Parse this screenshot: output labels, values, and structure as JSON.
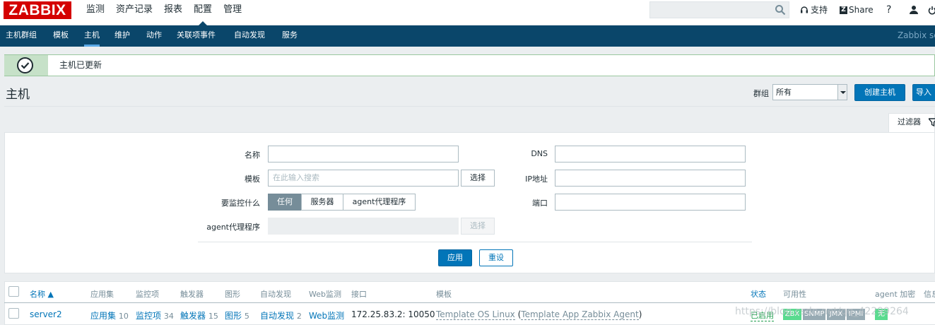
{
  "logo": "ZABBIX",
  "main_menu": [
    "监测",
    "资产记录",
    "报表",
    "配置",
    "管理"
  ],
  "main_menu_active": "配置",
  "search": {
    "placeholder": ""
  },
  "topright": {
    "support": "支持",
    "share": "Share",
    "help": "?"
  },
  "sub_menu": [
    "主机群组",
    "模板",
    "主机",
    "维护",
    "动作",
    "关联项事件",
    "自动发现",
    "服务"
  ],
  "sub_menu_active": "主机",
  "server_name": "Zabbix server",
  "message": "主机已更新",
  "page_title": "主机",
  "group_filter": {
    "label": "群组",
    "value": "所有"
  },
  "buttons": {
    "create_host": "创建主机",
    "import": "导入"
  },
  "filter_tab": "过滤器",
  "filter": {
    "name_label": "名称",
    "template_label": "模板",
    "template_placeholder": "在此输入搜索",
    "select": "选择",
    "monitored_by_label": "要监控什么",
    "monitored_by_options": [
      "任何",
      "服务器",
      "agent代理程序"
    ],
    "monitored_by_selected": "任何",
    "proxy_label": "agent代理程序",
    "dns_label": "DNS",
    "ip_label": "IP地址",
    "port_label": "端口",
    "apply": "应用",
    "reset": "重设"
  },
  "table": {
    "headers": [
      "名称 ▲",
      "应用集",
      "监控项",
      "触发器",
      "图形",
      "自动发现",
      "Web监测",
      "接口",
      "模板",
      "状态",
      "可用性",
      "agent 加密",
      "信息"
    ],
    "rows": [
      {
        "name": "server2",
        "applications": "应用集",
        "applications_count": "10",
        "items": "监控项",
        "items_count": "34",
        "triggers": "触发器",
        "triggers_count": "15",
        "graphs": "图形",
        "graphs_count": "5",
        "discovery": "自动发现",
        "discovery_count": "2",
        "web": "Web监测",
        "interface": "172.25.83.2: 10050",
        "template_main": "Template OS Linux",
        "template_parent": "Template App Zabbix Agent",
        "status": "已启用",
        "availability": [
          "ZBX",
          "SNMP",
          "JMX",
          "IPMI"
        ],
        "encryption": "无"
      }
    ]
  },
  "watermark": "https://blog.csdn.net/qq_42299264",
  "colors": {
    "accent": "#0275b8",
    "nav": "#0a466a",
    "ok": "#59db8f",
    "brand": "#d40000"
  }
}
